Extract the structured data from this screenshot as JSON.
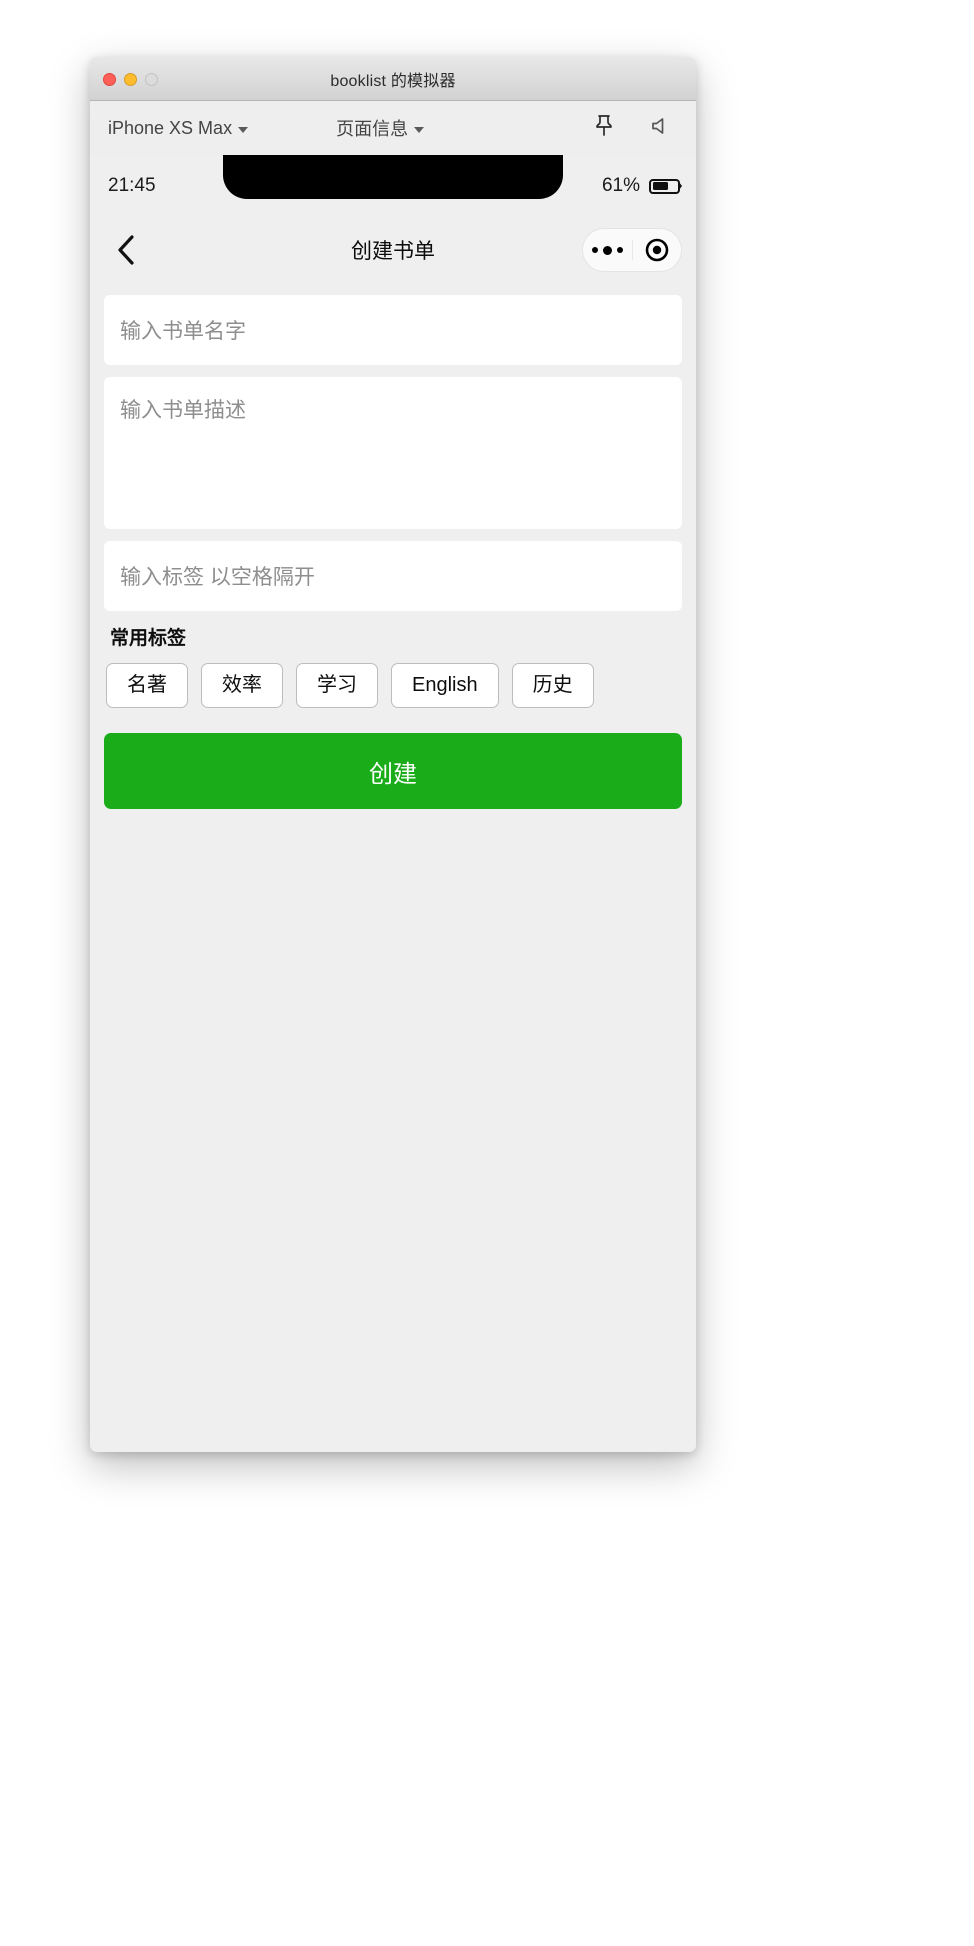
{
  "window": {
    "title": "booklist 的模拟器",
    "traffic_lights": [
      "close",
      "minimize",
      "zoom"
    ]
  },
  "toolbar": {
    "device": "iPhone XS Max",
    "page_info": "页面信息",
    "icons": [
      "pin-icon",
      "speaker-icon"
    ]
  },
  "status_bar": {
    "time": "21:45",
    "battery_percent": "61%",
    "battery_level": 61
  },
  "nav_bar": {
    "back_icon": "chevron-left-icon",
    "title": "创建书单",
    "capsule": {
      "menu_icon": "more-dots-icon",
      "target_icon": "target-icon"
    }
  },
  "form": {
    "name_placeholder": "输入书单名字",
    "name_value": "",
    "description_placeholder": "输入书单描述",
    "description_value": "",
    "tag_placeholder": "输入标签 以空格隔开",
    "tag_value": "",
    "tags_section_title": "常用标签",
    "common_tags": [
      "名著",
      "效率",
      "学习",
      "English",
      "历史"
    ],
    "submit_label": "创建",
    "submit_color": "#1aad19"
  }
}
